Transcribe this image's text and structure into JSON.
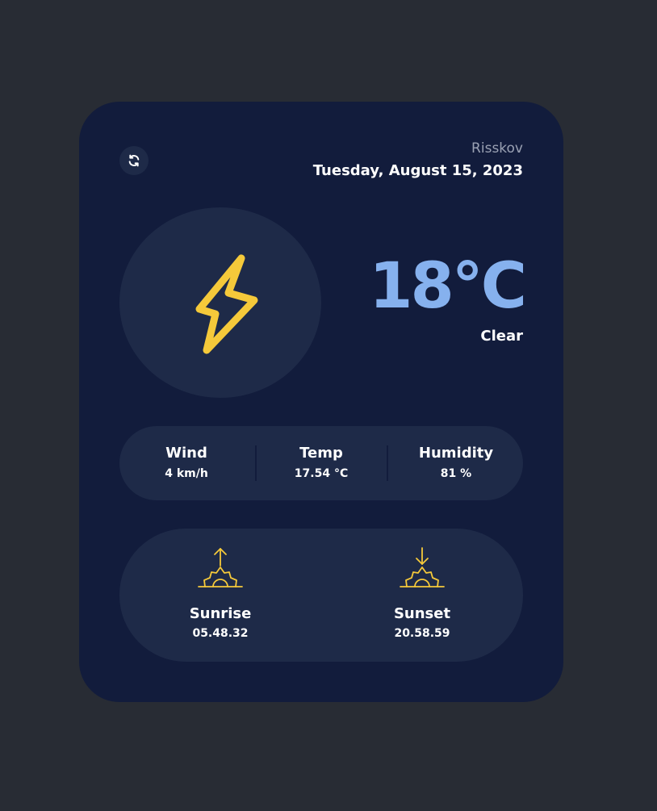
{
  "header": {
    "location": "Risskov",
    "date": "Tuesday, August 15, 2023"
  },
  "weather": {
    "icon": "lightning-icon",
    "temperature": "18°C",
    "condition": "Clear"
  },
  "stats": [
    {
      "label": "Wind",
      "value": "4 km/h"
    },
    {
      "label": "Temp",
      "value": "17.54 °C"
    },
    {
      "label": "Humidity",
      "value": "81 %"
    }
  ],
  "sun": {
    "sunrise": {
      "label": "Sunrise",
      "value": "05.48.32",
      "icon": "sunrise-icon"
    },
    "sunset": {
      "label": "Sunset",
      "value": "20.58.59",
      "icon": "sunset-icon"
    }
  },
  "colors": {
    "page_background": "#282c34",
    "card_background": "#121c3c",
    "panel_background": "#1e2a48",
    "temperature": "#86b1ee",
    "icon_accent": "#f5c93a",
    "location_text": "#9aa1b3",
    "text": "#ffffff"
  }
}
